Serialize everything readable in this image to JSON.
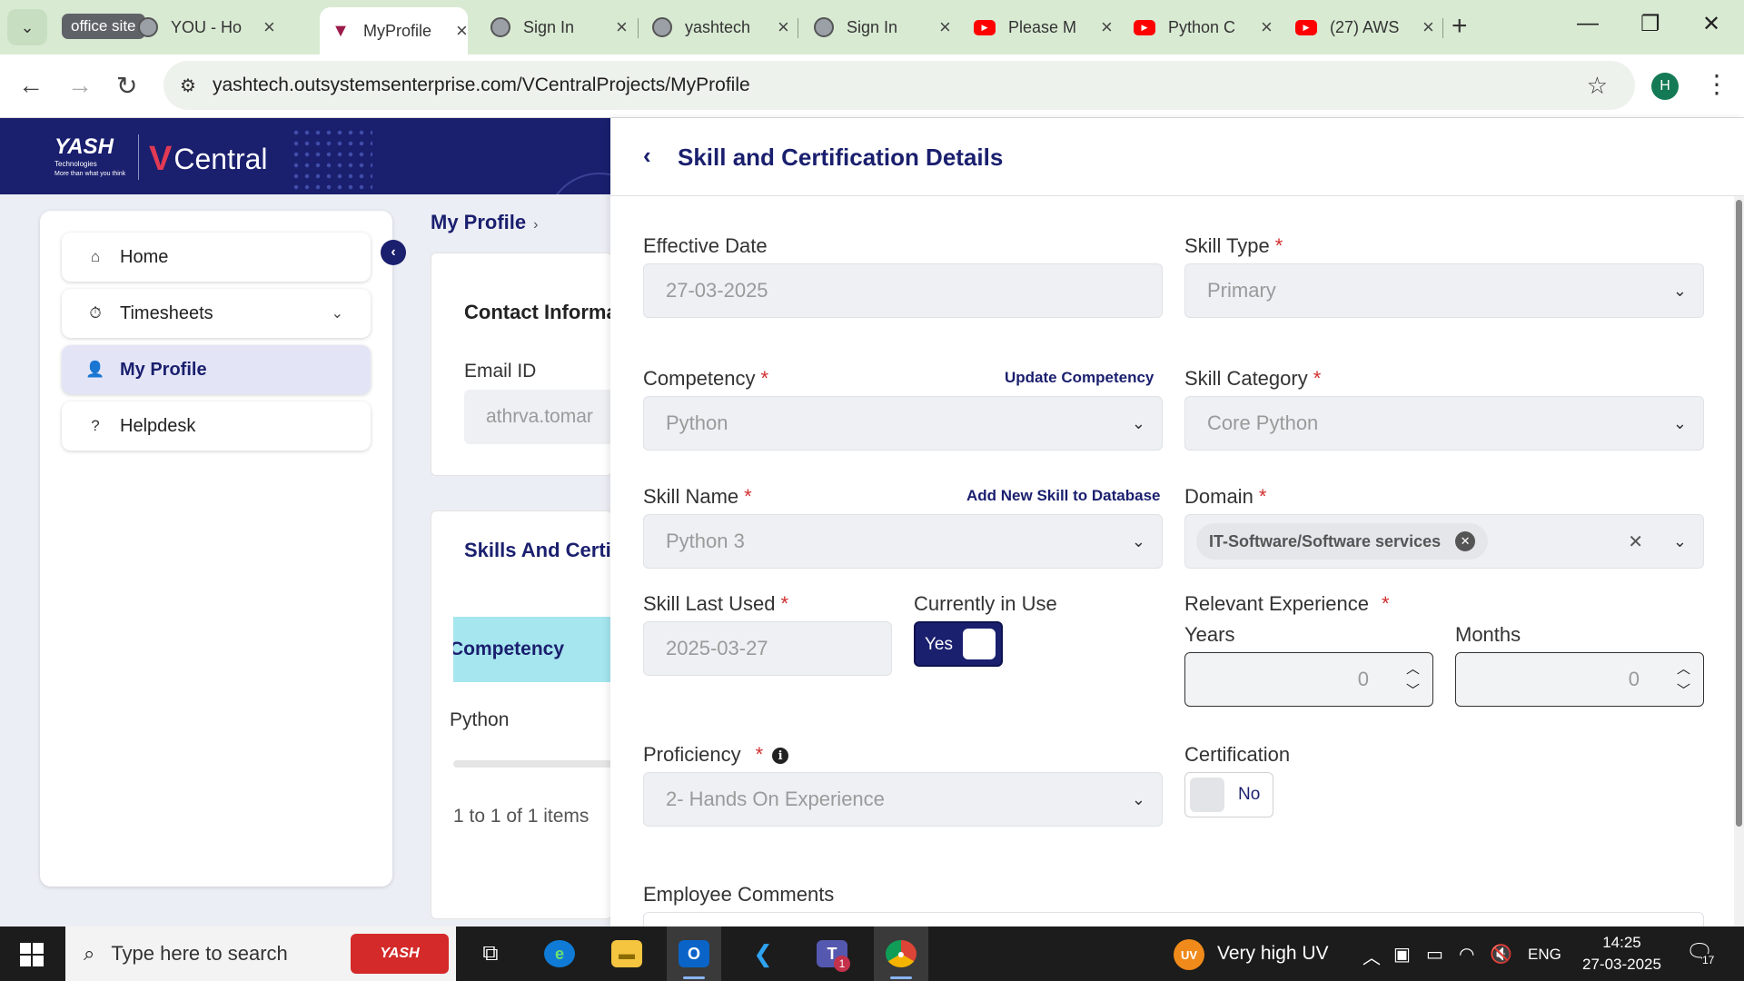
{
  "browser": {
    "tab_group": "office site",
    "tabs": [
      {
        "title": "YOU - Ho",
        "icon": "globe-icon"
      },
      {
        "title": "MyProfile",
        "icon": "vcentral-icon"
      },
      {
        "title": "Sign In",
        "icon": "globe-icon"
      },
      {
        "title": "yashtech",
        "icon": "globe-icon"
      },
      {
        "title": "Sign In",
        "icon": "globe-icon"
      },
      {
        "title": "Please M",
        "icon": "youtube-icon"
      },
      {
        "title": "Python C",
        "icon": "youtube-icon"
      },
      {
        "title": "(27) AWS",
        "icon": "youtube-icon"
      }
    ],
    "url": "yashtech.outsystemsenterprise.com/VCentralProjects/MyProfile",
    "profile_initial": "H"
  },
  "header": {
    "brand": "YASH",
    "brand_sub": "Technologies",
    "tagline": "More than what you think",
    "product": "Central"
  },
  "sidebar": {
    "items": [
      {
        "label": "Home",
        "icon": "home-icon"
      },
      {
        "label": "Timesheets",
        "icon": "stopwatch-icon"
      },
      {
        "label": "My Profile",
        "icon": "person-icon"
      },
      {
        "label": "Helpdesk",
        "icon": "help-icon"
      }
    ]
  },
  "main": {
    "breadcrumb": "My Profile",
    "contact_title": "Contact Information",
    "email_label": "Email ID",
    "email_value": "athrva.tomar",
    "skills_title": "Skills And Certifications",
    "grid_header": "Competency",
    "grid_row": "Python",
    "pager": "1 to 1 of 1 items"
  },
  "panel": {
    "title": "Skill and Certification Details",
    "effective_date": {
      "label": "Effective Date",
      "value": "27-03-2025"
    },
    "skill_type": {
      "label": "Skill Type",
      "value": "Primary"
    },
    "competency": {
      "label": "Competency",
      "value": "Python",
      "link": "Update Competency"
    },
    "skill_category": {
      "label": "Skill Category",
      "value": "Core Python"
    },
    "skill_name": {
      "label": "Skill Name",
      "value": "Python 3",
      "link": "Add New Skill to Database"
    },
    "domain": {
      "label": "Domain",
      "value": "IT-Software/Software services"
    },
    "skill_last_used": {
      "label": "Skill Last Used",
      "value": "2025-03-27"
    },
    "currently_in_use": {
      "label": "Currently in Use",
      "value": "Yes"
    },
    "relevant_experience": {
      "label": "Relevant Experience",
      "years_label": "Years",
      "years_value": "0",
      "months_label": "Months",
      "months_value": "0"
    },
    "proficiency": {
      "label": "Proficiency",
      "value": "2- Hands On Experience"
    },
    "certification": {
      "label": "Certification",
      "value": "No"
    },
    "employee_comments": {
      "label": "Employee Comments"
    },
    "required_mark": "*"
  },
  "taskbar": {
    "search_placeholder": "Type here to search",
    "search_badge": "YASH",
    "teams_badge": "1",
    "weather": "Very high UV",
    "weather_badge": "UV",
    "language": "ENG",
    "time": "14:25",
    "date": "27-03-2025",
    "notifications": "17"
  },
  "colors": {
    "brand_navy": "#1a1f6e",
    "accent_red": "#d32f2f",
    "grid_header": "#a6e6ef",
    "tabbar": "#d9ead3"
  }
}
